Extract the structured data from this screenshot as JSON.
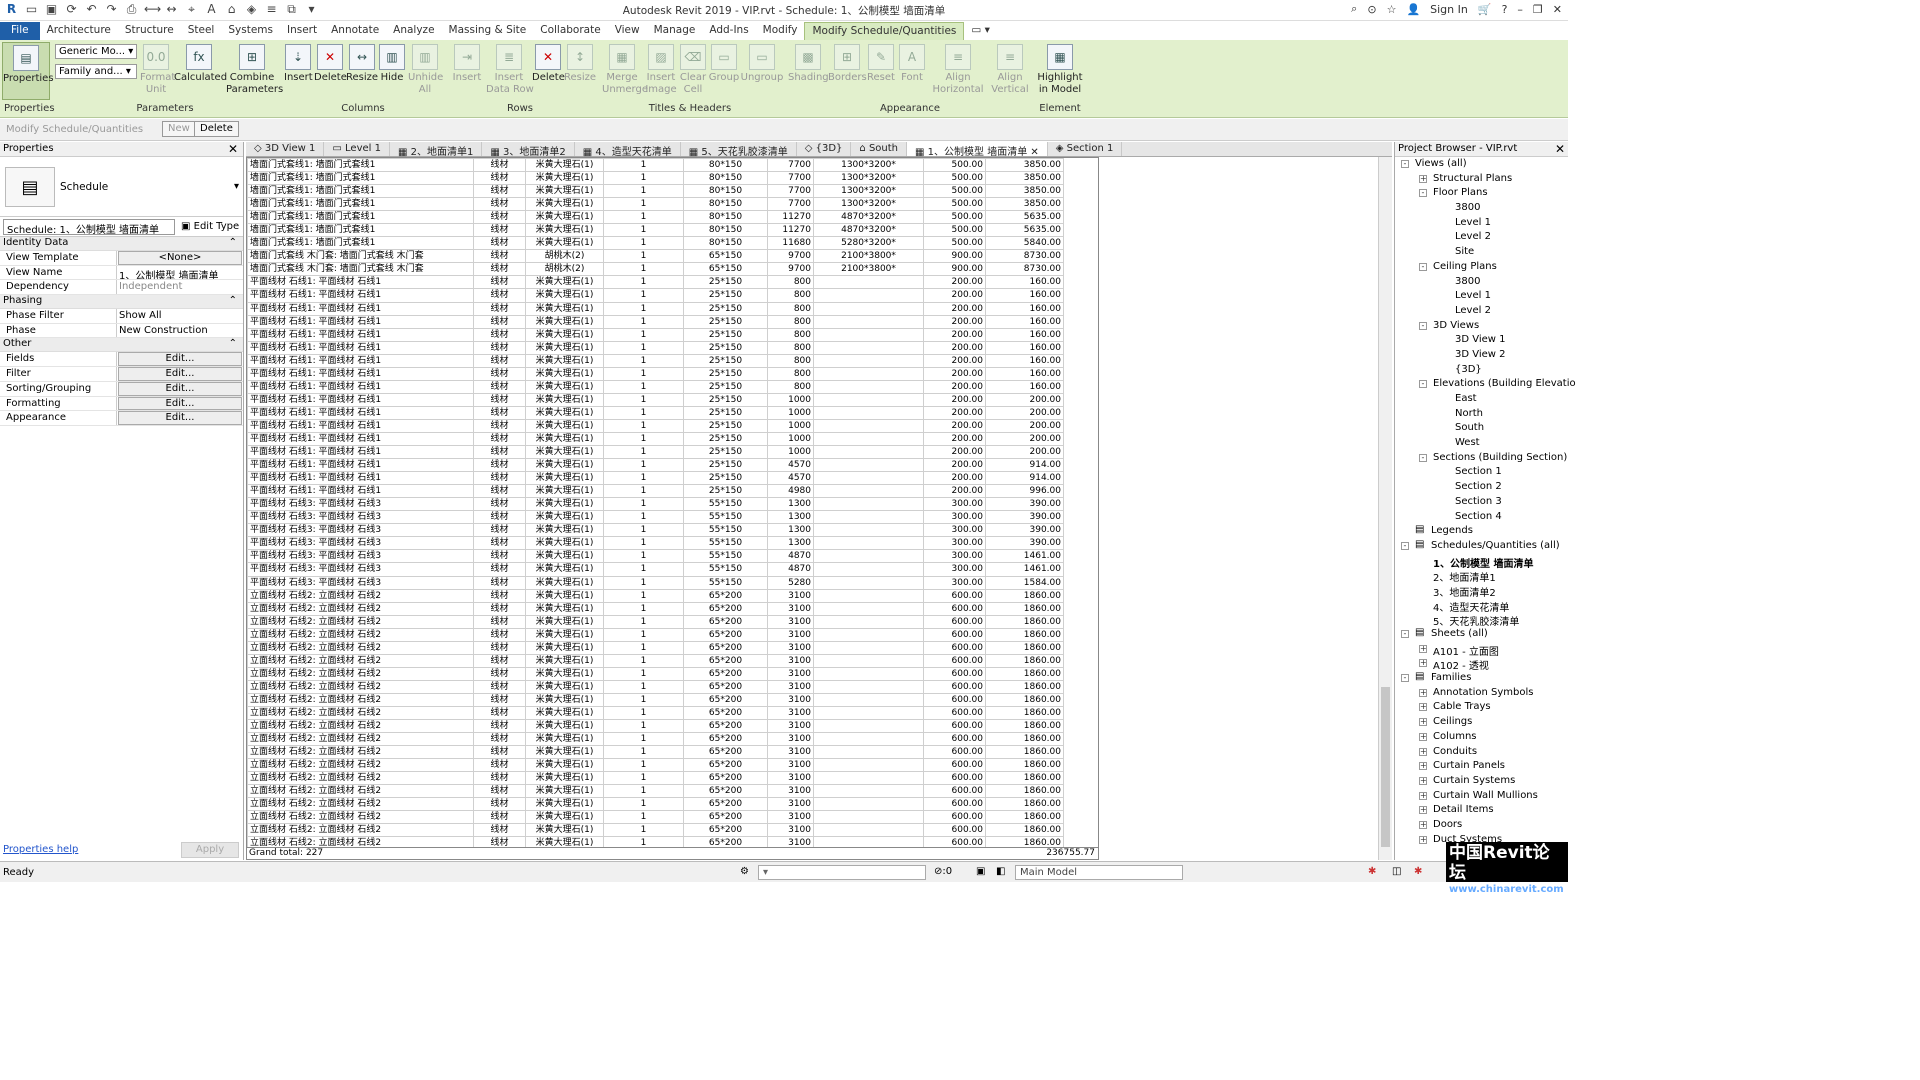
{
  "app": {
    "title": "Autodesk Revit 2019 - VIP.rvt - Schedule: 1、公制模型 墙面清单",
    "sign_in": "Sign In"
  },
  "menu_tabs": [
    "File",
    "Architecture",
    "Structure",
    "Steel",
    "Systems",
    "Insert",
    "Annotate",
    "Analyze",
    "Massing & Site",
    "Collaborate",
    "View",
    "Manage",
    "Add-Ins",
    "Modify",
    "Modify Schedule/Quantities"
  ],
  "ribbon": {
    "properties": "Properties",
    "dropdown_generic": "Generic Mo...",
    "dropdown_family": "Family and...",
    "format_unit": "Format\nUnit",
    "calculated": "Calculated",
    "combine_parameters": "Combine\nParameters",
    "col_insert": "Insert",
    "col_delete": "Delete",
    "col_resize": "Resize",
    "col_hide": "Hide",
    "col_unhide": "Unhide\nAll",
    "row_insert": "Insert",
    "row_insert_data": "Insert\nData Row",
    "row_delete": "Delete",
    "row_resize": "Resize",
    "merge": "Merge\nUnmerge",
    "insert_image": "Insert\nImage",
    "clear_cell": "Clear\nCell",
    "group": "Group",
    "ungroup": "Ungroup",
    "shading": "Shading",
    "borders": "Borders",
    "reset": "Reset",
    "font": "Font",
    "align_h": "Align\nHorizontal",
    "align_v": "Align\nVertical",
    "highlight": "Highlight\nin Model",
    "panels": [
      "Properties",
      "Parameters",
      "Columns",
      "Rows",
      "Titles & Headers",
      "Appearance",
      "Element"
    ]
  },
  "context_bar": {
    "label": "Modify Schedule/Quantities",
    "new": "New",
    "delete": "Delete"
  },
  "properties": {
    "title": "Properties",
    "type_name": "Schedule",
    "selector": "Schedule: 1、公制模型 墙面清单",
    "edit_type": "Edit Type",
    "groups": [
      {
        "name": "Identity Data",
        "rows": [
          {
            "k": "View Template",
            "v": "<None>",
            "kind": "btn"
          },
          {
            "k": "View Name",
            "v": "1、公制模型 墙面清单",
            "kind": "text"
          },
          {
            "k": "Dependency",
            "v": "Independent",
            "kind": "gray"
          }
        ]
      },
      {
        "name": "Phasing",
        "rows": [
          {
            "k": "Phase Filter",
            "v": "Show All",
            "kind": "text"
          },
          {
            "k": "Phase",
            "v": "New Construction",
            "kind": "text"
          }
        ]
      },
      {
        "name": "Other",
        "rows": [
          {
            "k": "Fields",
            "v": "Edit...",
            "kind": "btn"
          },
          {
            "k": "Filter",
            "v": "Edit...",
            "kind": "btn"
          },
          {
            "k": "Sorting/Grouping",
            "v": "Edit...",
            "kind": "btn"
          },
          {
            "k": "Formatting",
            "v": "Edit...",
            "kind": "btn"
          },
          {
            "k": "Appearance",
            "v": "Edit...",
            "kind": "btn"
          }
        ]
      }
    ],
    "help": "Properties help",
    "apply": "Apply"
  },
  "view_tabs": [
    {
      "label": "3D View 1",
      "icon": "◇"
    },
    {
      "label": "Level 1",
      "icon": "▭"
    },
    {
      "label": "2、地面清单1",
      "icon": "▦"
    },
    {
      "label": "3、地面清单2",
      "icon": "▦"
    },
    {
      "label": "4、造型天花清单",
      "icon": "▦"
    },
    {
      "label": "5、天花乳胶漆清单",
      "icon": "▦"
    },
    {
      "label": "{3D}",
      "icon": "◇"
    },
    {
      "label": "South",
      "icon": "⌂"
    },
    {
      "label": "1、公制模型 墙面清单",
      "icon": "▦",
      "active": true
    },
    {
      "label": "Section 1",
      "icon": "◈"
    }
  ],
  "schedule": {
    "rows": [
      [
        "墙面门式套线1: 墙面门式套线1",
        "线材",
        "米黄大理石(1)",
        "1",
        "80*150",
        "7700",
        "1300*3200*",
        "500.00",
        "3850.00"
      ],
      [
        "墙面门式套线1: 墙面门式套线1",
        "线材",
        "米黄大理石(1)",
        "1",
        "80*150",
        "7700",
        "1300*3200*",
        "500.00",
        "3850.00"
      ],
      [
        "墙面门式套线1: 墙面门式套线1",
        "线材",
        "米黄大理石(1)",
        "1",
        "80*150",
        "7700",
        "1300*3200*",
        "500.00",
        "3850.00"
      ],
      [
        "墙面门式套线1: 墙面门式套线1",
        "线材",
        "米黄大理石(1)",
        "1",
        "80*150",
        "7700",
        "1300*3200*",
        "500.00",
        "3850.00"
      ],
      [
        "墙面门式套线1: 墙面门式套线1",
        "线材",
        "米黄大理石(1)",
        "1",
        "80*150",
        "11270",
        "4870*3200*",
        "500.00",
        "5635.00"
      ],
      [
        "墙面门式套线1: 墙面门式套线1",
        "线材",
        "米黄大理石(1)",
        "1",
        "80*150",
        "11270",
        "4870*3200*",
        "500.00",
        "5635.00"
      ],
      [
        "墙面门式套线1: 墙面门式套线1",
        "线材",
        "米黄大理石(1)",
        "1",
        "80*150",
        "11680",
        "5280*3200*",
        "500.00",
        "5840.00"
      ],
      [
        "墙面门式套线 木门套: 墙面门式套线 木门套",
        "线材",
        "胡桃木(2)",
        "1",
        "65*150",
        "9700",
        "2100*3800*",
        "900.00",
        "8730.00"
      ],
      [
        "墙面门式套线 木门套: 墙面门式套线 木门套",
        "线材",
        "胡桃木(2)",
        "1",
        "65*150",
        "9700",
        "2100*3800*",
        "900.00",
        "8730.00"
      ],
      [
        "平面线材 石线1: 平面线材 石线1",
        "线材",
        "米黄大理石(1)",
        "1",
        "25*150",
        "800",
        "",
        "200.00",
        "160.00"
      ],
      [
        "平面线材 石线1: 平面线材 石线1",
        "线材",
        "米黄大理石(1)",
        "1",
        "25*150",
        "800",
        "",
        "200.00",
        "160.00"
      ],
      [
        "平面线材 石线1: 平面线材 石线1",
        "线材",
        "米黄大理石(1)",
        "1",
        "25*150",
        "800",
        "",
        "200.00",
        "160.00"
      ],
      [
        "平面线材 石线1: 平面线材 石线1",
        "线材",
        "米黄大理石(1)",
        "1",
        "25*150",
        "800",
        "",
        "200.00",
        "160.00"
      ],
      [
        "平面线材 石线1: 平面线材 石线1",
        "线材",
        "米黄大理石(1)",
        "1",
        "25*150",
        "800",
        "",
        "200.00",
        "160.00"
      ],
      [
        "平面线材 石线1: 平面线材 石线1",
        "线材",
        "米黄大理石(1)",
        "1",
        "25*150",
        "800",
        "",
        "200.00",
        "160.00"
      ],
      [
        "平面线材 石线1: 平面线材 石线1",
        "线材",
        "米黄大理石(1)",
        "1",
        "25*150",
        "800",
        "",
        "200.00",
        "160.00"
      ],
      [
        "平面线材 石线1: 平面线材 石线1",
        "线材",
        "米黄大理石(1)",
        "1",
        "25*150",
        "800",
        "",
        "200.00",
        "160.00"
      ],
      [
        "平面线材 石线1: 平面线材 石线1",
        "线材",
        "米黄大理石(1)",
        "1",
        "25*150",
        "800",
        "",
        "200.00",
        "160.00"
      ],
      [
        "平面线材 石线1: 平面线材 石线1",
        "线材",
        "米黄大理石(1)",
        "1",
        "25*150",
        "1000",
        "",
        "200.00",
        "200.00"
      ],
      [
        "平面线材 石线1: 平面线材 石线1",
        "线材",
        "米黄大理石(1)",
        "1",
        "25*150",
        "1000",
        "",
        "200.00",
        "200.00"
      ],
      [
        "平面线材 石线1: 平面线材 石线1",
        "线材",
        "米黄大理石(1)",
        "1",
        "25*150",
        "1000",
        "",
        "200.00",
        "200.00"
      ],
      [
        "平面线材 石线1: 平面线材 石线1",
        "线材",
        "米黄大理石(1)",
        "1",
        "25*150",
        "1000",
        "",
        "200.00",
        "200.00"
      ],
      [
        "平面线材 石线1: 平面线材 石线1",
        "线材",
        "米黄大理石(1)",
        "1",
        "25*150",
        "1000",
        "",
        "200.00",
        "200.00"
      ],
      [
        "平面线材 石线1: 平面线材 石线1",
        "线材",
        "米黄大理石(1)",
        "1",
        "25*150",
        "4570",
        "",
        "200.00",
        "914.00"
      ],
      [
        "平面线材 石线1: 平面线材 石线1",
        "线材",
        "米黄大理石(1)",
        "1",
        "25*150",
        "4570",
        "",
        "200.00",
        "914.00"
      ],
      [
        "平面线材 石线1: 平面线材 石线1",
        "线材",
        "米黄大理石(1)",
        "1",
        "25*150",
        "4980",
        "",
        "200.00",
        "996.00"
      ],
      [
        "平面线材 石线3: 平面线材 石线3",
        "线材",
        "米黄大理石(1)",
        "1",
        "55*150",
        "1300",
        "",
        "300.00",
        "390.00"
      ],
      [
        "平面线材 石线3: 平面线材 石线3",
        "线材",
        "米黄大理石(1)",
        "1",
        "55*150",
        "1300",
        "",
        "300.00",
        "390.00"
      ],
      [
        "平面线材 石线3: 平面线材 石线3",
        "线材",
        "米黄大理石(1)",
        "1",
        "55*150",
        "1300",
        "",
        "300.00",
        "390.00"
      ],
      [
        "平面线材 石线3: 平面线材 石线3",
        "线材",
        "米黄大理石(1)",
        "1",
        "55*150",
        "1300",
        "",
        "300.00",
        "390.00"
      ],
      [
        "平面线材 石线3: 平面线材 石线3",
        "线材",
        "米黄大理石(1)",
        "1",
        "55*150",
        "4870",
        "",
        "300.00",
        "1461.00"
      ],
      [
        "平面线材 石线3: 平面线材 石线3",
        "线材",
        "米黄大理石(1)",
        "1",
        "55*150",
        "4870",
        "",
        "300.00",
        "1461.00"
      ],
      [
        "平面线材 石线3: 平面线材 石线3",
        "线材",
        "米黄大理石(1)",
        "1",
        "55*150",
        "5280",
        "",
        "300.00",
        "1584.00"
      ],
      [
        "立面线材 石线2: 立面线材 石线2",
        "线材",
        "米黄大理石(1)",
        "1",
        "65*200",
        "3100",
        "",
        "600.00",
        "1860.00"
      ],
      [
        "立面线材 石线2: 立面线材 石线2",
        "线材",
        "米黄大理石(1)",
        "1",
        "65*200",
        "3100",
        "",
        "600.00",
        "1860.00"
      ],
      [
        "立面线材 石线2: 立面线材 石线2",
        "线材",
        "米黄大理石(1)",
        "1",
        "65*200",
        "3100",
        "",
        "600.00",
        "1860.00"
      ],
      [
        "立面线材 石线2: 立面线材 石线2",
        "线材",
        "米黄大理石(1)",
        "1",
        "65*200",
        "3100",
        "",
        "600.00",
        "1860.00"
      ],
      [
        "立面线材 石线2: 立面线材 石线2",
        "线材",
        "米黄大理石(1)",
        "1",
        "65*200",
        "3100",
        "",
        "600.00",
        "1860.00"
      ],
      [
        "立面线材 石线2: 立面线材 石线2",
        "线材",
        "米黄大理石(1)",
        "1",
        "65*200",
        "3100",
        "",
        "600.00",
        "1860.00"
      ],
      [
        "立面线材 石线2: 立面线材 石线2",
        "线材",
        "米黄大理石(1)",
        "1",
        "65*200",
        "3100",
        "",
        "600.00",
        "1860.00"
      ],
      [
        "立面线材 石线2: 立面线材 石线2",
        "线材",
        "米黄大理石(1)",
        "1",
        "65*200",
        "3100",
        "",
        "600.00",
        "1860.00"
      ],
      [
        "立面线材 石线2: 立面线材 石线2",
        "线材",
        "米黄大理石(1)",
        "1",
        "65*200",
        "3100",
        "",
        "600.00",
        "1860.00"
      ],
      [
        "立面线材 石线2: 立面线材 石线2",
        "线材",
        "米黄大理石(1)",
        "1",
        "65*200",
        "3100",
        "",
        "600.00",
        "1860.00"
      ],
      [
        "立面线材 石线2: 立面线材 石线2",
        "线材",
        "米黄大理石(1)",
        "1",
        "65*200",
        "3100",
        "",
        "600.00",
        "1860.00"
      ],
      [
        "立面线材 石线2: 立面线材 石线2",
        "线材",
        "米黄大理石(1)",
        "1",
        "65*200",
        "3100",
        "",
        "600.00",
        "1860.00"
      ],
      [
        "立面线材 石线2: 立面线材 石线2",
        "线材",
        "米黄大理石(1)",
        "1",
        "65*200",
        "3100",
        "",
        "600.00",
        "1860.00"
      ],
      [
        "立面线材 石线2: 立面线材 石线2",
        "线材",
        "米黄大理石(1)",
        "1",
        "65*200",
        "3100",
        "",
        "600.00",
        "1860.00"
      ],
      [
        "立面线材 石线2: 立面线材 石线2",
        "线材",
        "米黄大理石(1)",
        "1",
        "65*200",
        "3100",
        "",
        "600.00",
        "1860.00"
      ],
      [
        "立面线材 石线2: 立面线材 石线2",
        "线材",
        "米黄大理石(1)",
        "1",
        "65*200",
        "3100",
        "",
        "600.00",
        "1860.00"
      ],
      [
        "立面线材 石线2: 立面线材 石线2",
        "线材",
        "米黄大理石(1)",
        "1",
        "65*200",
        "3100",
        "",
        "600.00",
        "1860.00"
      ],
      [
        "立面线材 石线2: 立面线材 石线2",
        "线材",
        "米黄大理石(1)",
        "1",
        "65*200",
        "3100",
        "",
        "600.00",
        "1860.00"
      ],
      [
        "立面线材 石线2: 立面线材 石线2",
        "线材",
        "米黄大理石(1)",
        "1",
        "65*200",
        "3100",
        "",
        "600.00",
        "1860.00"
      ],
      [
        "立面线材 石线2: 立面线材 石线2",
        "线材",
        "米黄大理石(1)",
        "1",
        "65*200",
        "3100",
        "",
        "600.00",
        "1860.00"
      ],
      [
        "立面线材 石线2: 立面线材 石线2",
        "线材",
        "米黄大理石(1)",
        "1",
        "65*200",
        "3100",
        "",
        "600.00",
        "1860.00"
      ]
    ],
    "grand_total_label": "Grand total: 227",
    "grand_total_value": "236755.77"
  },
  "project_browser": {
    "title": "Project Browser - VIP.rvt",
    "nodes": [
      {
        "d": 0,
        "t": "-",
        "l": "Views (all)"
      },
      {
        "d": 1,
        "t": "+",
        "l": "Structural Plans"
      },
      {
        "d": 1,
        "t": "-",
        "l": "Floor Plans"
      },
      {
        "d": 2,
        "t": "",
        "l": "3800"
      },
      {
        "d": 2,
        "t": "",
        "l": "Level 1"
      },
      {
        "d": 2,
        "t": "",
        "l": "Level 2"
      },
      {
        "d": 2,
        "t": "",
        "l": "Site"
      },
      {
        "d": 1,
        "t": "-",
        "l": "Ceiling Plans"
      },
      {
        "d": 2,
        "t": "",
        "l": "3800"
      },
      {
        "d": 2,
        "t": "",
        "l": "Level 1"
      },
      {
        "d": 2,
        "t": "",
        "l": "Level 2"
      },
      {
        "d": 1,
        "t": "-",
        "l": "3D Views"
      },
      {
        "d": 2,
        "t": "",
        "l": "3D View 1"
      },
      {
        "d": 2,
        "t": "",
        "l": "3D View 2"
      },
      {
        "d": 2,
        "t": "",
        "l": "{3D}"
      },
      {
        "d": 1,
        "t": "-",
        "l": "Elevations (Building Elevatio"
      },
      {
        "d": 2,
        "t": "",
        "l": "East"
      },
      {
        "d": 2,
        "t": "",
        "l": "North"
      },
      {
        "d": 2,
        "t": "",
        "l": "South"
      },
      {
        "d": 2,
        "t": "",
        "l": "West"
      },
      {
        "d": 1,
        "t": "-",
        "l": "Sections (Building Section)"
      },
      {
        "d": 2,
        "t": "",
        "l": "Section 1"
      },
      {
        "d": 2,
        "t": "",
        "l": "Section 2"
      },
      {
        "d": 2,
        "t": "",
        "l": "Section 3"
      },
      {
        "d": 2,
        "t": "",
        "l": "Section 4"
      },
      {
        "d": 0,
        "t": "",
        "l": "Legends",
        "icon": true
      },
      {
        "d": 0,
        "t": "-",
        "l": "Schedules/Quantities (all)",
        "icon": true
      },
      {
        "d": 1,
        "t": "",
        "l": "1、公制模型 墙面清单",
        "bold": true
      },
      {
        "d": 1,
        "t": "",
        "l": "2、地面清单1"
      },
      {
        "d": 1,
        "t": "",
        "l": "3、地面清单2"
      },
      {
        "d": 1,
        "t": "",
        "l": "4、造型天花清单"
      },
      {
        "d": 1,
        "t": "",
        "l": "5、天花乳胶漆清单"
      },
      {
        "d": 0,
        "t": "-",
        "l": "Sheets (all)",
        "icon": true
      },
      {
        "d": 1,
        "t": "+",
        "l": "A101 - 立面图"
      },
      {
        "d": 1,
        "t": "+",
        "l": "A102 - 透视"
      },
      {
        "d": 0,
        "t": "-",
        "l": "Families",
        "icon": true
      },
      {
        "d": 1,
        "t": "+",
        "l": "Annotation Symbols"
      },
      {
        "d": 1,
        "t": "+",
        "l": "Cable Trays"
      },
      {
        "d": 1,
        "t": "+",
        "l": "Ceilings"
      },
      {
        "d": 1,
        "t": "+",
        "l": "Columns"
      },
      {
        "d": 1,
        "t": "+",
        "l": "Conduits"
      },
      {
        "d": 1,
        "t": "+",
        "l": "Curtain Panels"
      },
      {
        "d": 1,
        "t": "+",
        "l": "Curtain Systems"
      },
      {
        "d": 1,
        "t": "+",
        "l": "Curtain Wall Mullions"
      },
      {
        "d": 1,
        "t": "+",
        "l": "Detail Items"
      },
      {
        "d": 1,
        "t": "+",
        "l": "Doors"
      },
      {
        "d": 1,
        "t": "+",
        "l": "Duct Systems"
      }
    ]
  },
  "status": {
    "ready": "Ready",
    "selection_count": ":0",
    "model": "Main Model"
  },
  "watermark": {
    "cn": "中国Revit论坛",
    "url": "www.chinarevit.com"
  },
  "colors": {
    "ribbon_bg": "#e2f0cd",
    "file_tab": "#1f5fa8"
  }
}
